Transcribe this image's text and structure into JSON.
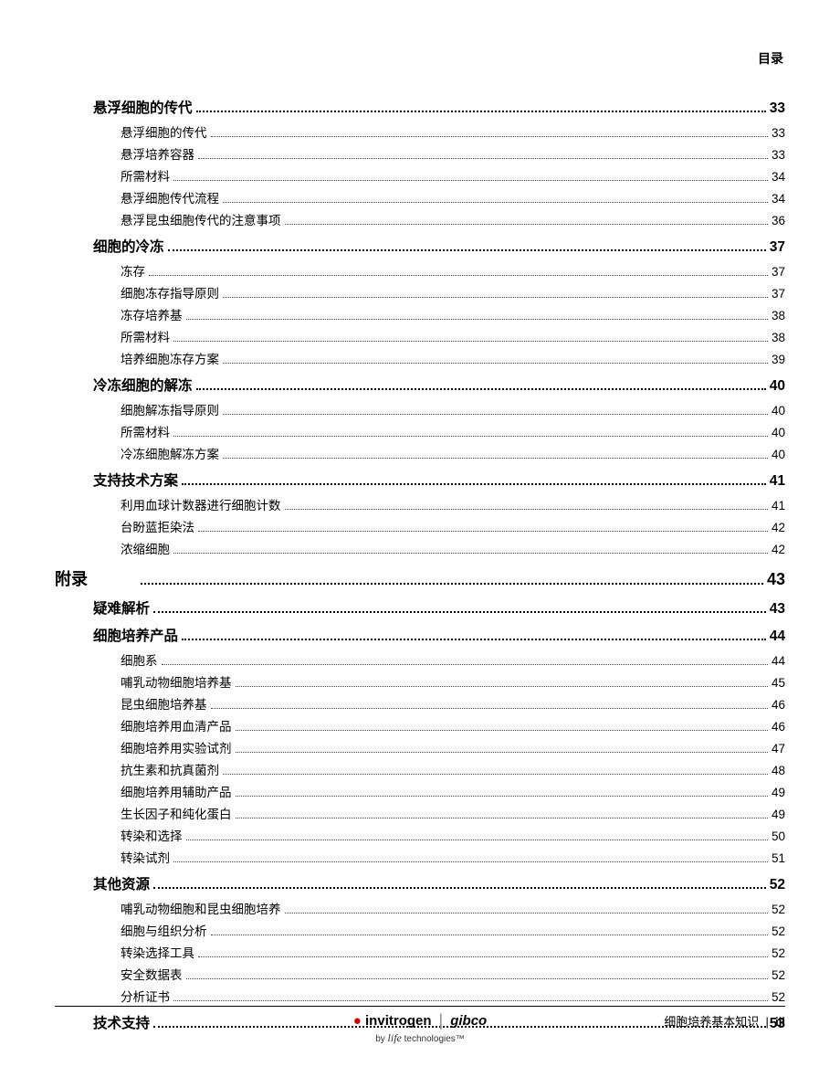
{
  "header": {
    "label": "目录"
  },
  "toc": {
    "items": [
      {
        "level": 1,
        "label": "悬浮细胞的传代",
        "page": "33"
      },
      {
        "level": 2,
        "label": "悬浮细胞的传代",
        "page": "33"
      },
      {
        "level": 2,
        "label": "悬浮培养容器",
        "page": "33"
      },
      {
        "level": 2,
        "label": "所需材料",
        "page": "34"
      },
      {
        "level": 2,
        "label": "悬浮细胞传代流程",
        "page": "34"
      },
      {
        "level": 2,
        "label": "悬浮昆虫细胞传代的注意事项",
        "page": "36"
      },
      {
        "level": 1,
        "label": "细胞的冷冻",
        "page": "37"
      },
      {
        "level": 2,
        "label": "冻存",
        "page": "37"
      },
      {
        "level": 2,
        "label": "细胞冻存指导原则",
        "page": "37"
      },
      {
        "level": 2,
        "label": "冻存培养基",
        "page": "38"
      },
      {
        "level": 2,
        "label": "所需材料",
        "page": "38"
      },
      {
        "level": 2,
        "label": "培养细胞冻存方案",
        "page": "39"
      },
      {
        "level": 1,
        "label": "冷冻细胞的解冻",
        "page": "40"
      },
      {
        "level": 2,
        "label": "细胞解冻指导原则",
        "page": "40"
      },
      {
        "level": 2,
        "label": "所需材料",
        "page": "40"
      },
      {
        "level": 2,
        "label": "冷冻细胞解冻方案",
        "page": "40"
      },
      {
        "level": 1,
        "label": "支持技术方案",
        "page": "41"
      },
      {
        "level": 2,
        "label": "利用血球计数器进行细胞计数",
        "page": "41"
      },
      {
        "level": 2,
        "label": "台盼蓝拒染法",
        "page": "42"
      },
      {
        "level": 2,
        "label": "浓缩细胞",
        "page": "42"
      },
      {
        "level": 0,
        "label": "附录",
        "page": "43"
      },
      {
        "level": 1,
        "label": "疑难解析",
        "page": "43"
      },
      {
        "level": 1,
        "label": "细胞培养产品",
        "page": "44"
      },
      {
        "level": 2,
        "label": "细胞系",
        "page": "44"
      },
      {
        "level": 2,
        "label": "哺乳动物细胞培养基",
        "page": "45"
      },
      {
        "level": 2,
        "label": "昆虫细胞培养基",
        "page": "46"
      },
      {
        "level": 2,
        "label": "细胞培养用血清产品",
        "page": "46"
      },
      {
        "level": 2,
        "label": "细胞培养用实验试剂",
        "page": "47"
      },
      {
        "level": 2,
        "label": "抗生素和抗真菌剂",
        "page": "48"
      },
      {
        "level": 2,
        "label": "细胞培养用辅助产品",
        "page": "49"
      },
      {
        "level": 2,
        "label": "生长因子和纯化蛋白",
        "page": "49"
      },
      {
        "level": 2,
        "label": "转染和选择",
        "page": "50"
      },
      {
        "level": 2,
        "label": "转染试剂",
        "page": "51"
      },
      {
        "level": 1,
        "label": "其他资源",
        "page": "52"
      },
      {
        "level": 2,
        "label": "哺乳动物细胞和昆虫细胞培养",
        "page": "52"
      },
      {
        "level": 2,
        "label": "细胞与组织分析",
        "page": "52"
      },
      {
        "level": 2,
        "label": "转染选择工具",
        "page": "52"
      },
      {
        "level": 2,
        "label": "安全数据表",
        "page": "52"
      },
      {
        "level": 2,
        "label": "分析证书",
        "page": "52"
      },
      {
        "level": 1,
        "label": "技术支持",
        "page": "53"
      }
    ]
  },
  "footer": {
    "brand1": "invitrogen",
    "brand2": "gibco",
    "tagline_prefix": "by",
    "tagline_script": "life",
    "tagline_suffix": "technologies™",
    "doc_title": "细胞培养基本知识",
    "page_sep": "|",
    "page_num": "iii"
  }
}
